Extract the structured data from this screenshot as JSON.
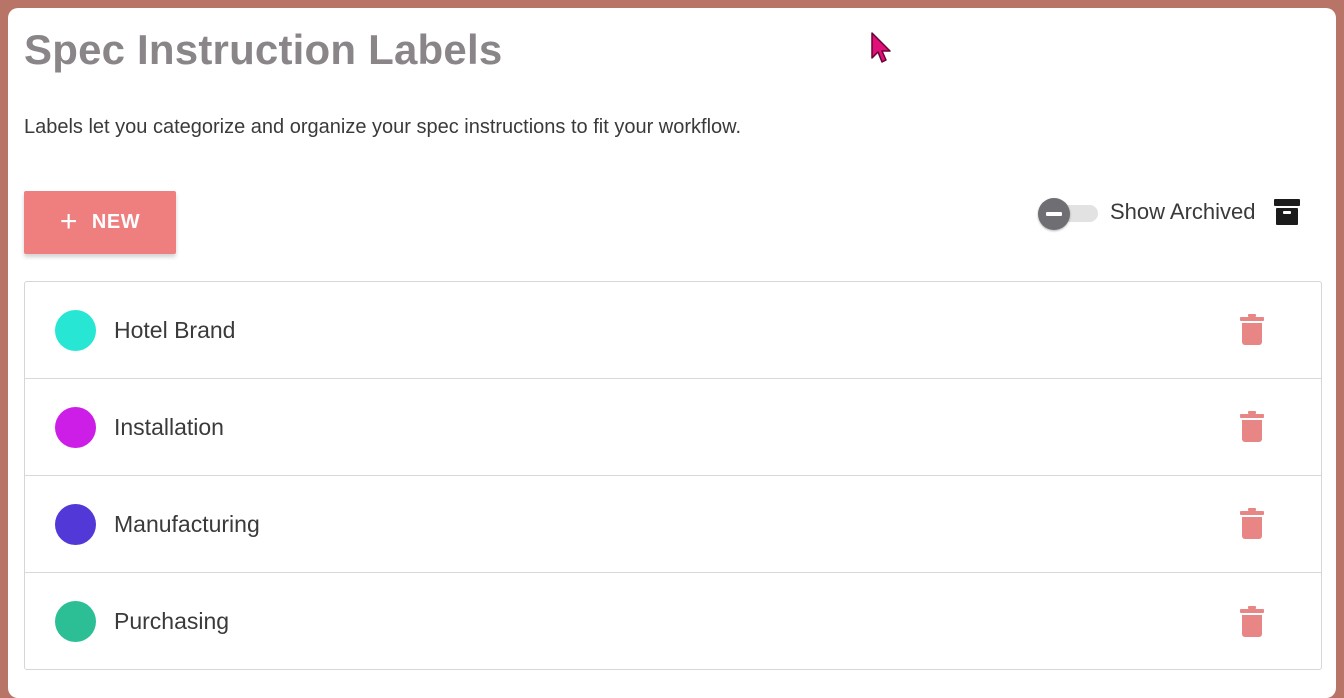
{
  "page": {
    "title": "Spec Instruction Labels",
    "description": "Labels let you categorize and organize your spec instructions to fit your workflow."
  },
  "toolbar": {
    "new_label": "NEW",
    "new_icon": "plus-icon",
    "show_archived_label": "Show Archived",
    "show_archived_on": false,
    "archive_icon": "archive-box-icon"
  },
  "labels": [
    {
      "name": "Hotel Brand",
      "color": "#27e6d4"
    },
    {
      "name": "Installation",
      "color": "#cc1ee6"
    },
    {
      "name": "Manufacturing",
      "color": "#5238d6"
    },
    {
      "name": "Purchasing",
      "color": "#2cbf96"
    }
  ],
  "row_action_icon": "trash-icon",
  "colors": {
    "accent": "#ef7f7f",
    "trash": "#e88585",
    "frame": "#b87466",
    "title": "#8a8589"
  }
}
